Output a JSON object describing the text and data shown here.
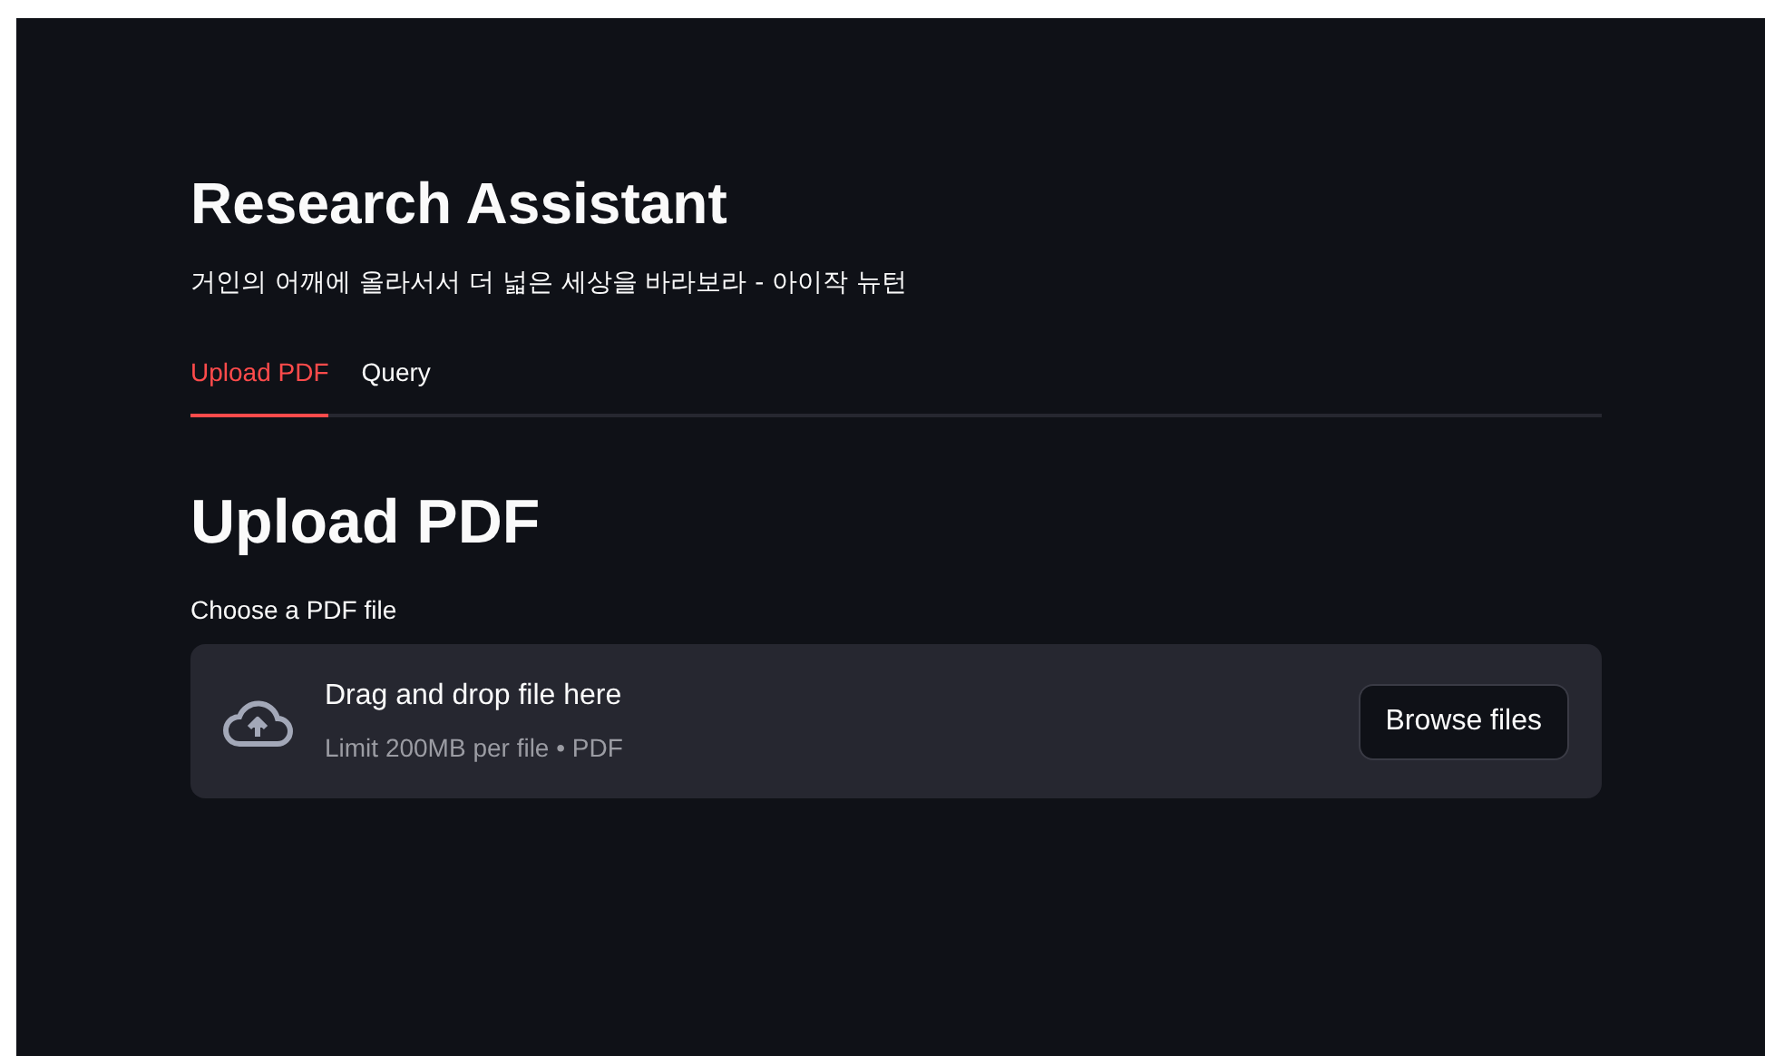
{
  "title": "Research Assistant",
  "subtitle": "거인의 어깨에 올라서서 더 넓은 세상을 바라보라 - 아이작 뉴턴",
  "tabs": [
    {
      "label": "Upload PDF",
      "selected": true
    },
    {
      "label": "Query",
      "selected": false
    }
  ],
  "section_heading": "Upload PDF",
  "uploader": {
    "label": "Choose a PDF file",
    "instruction": "Drag and drop file here",
    "limit": "Limit 200MB per file • PDF",
    "button": "Browse files"
  }
}
